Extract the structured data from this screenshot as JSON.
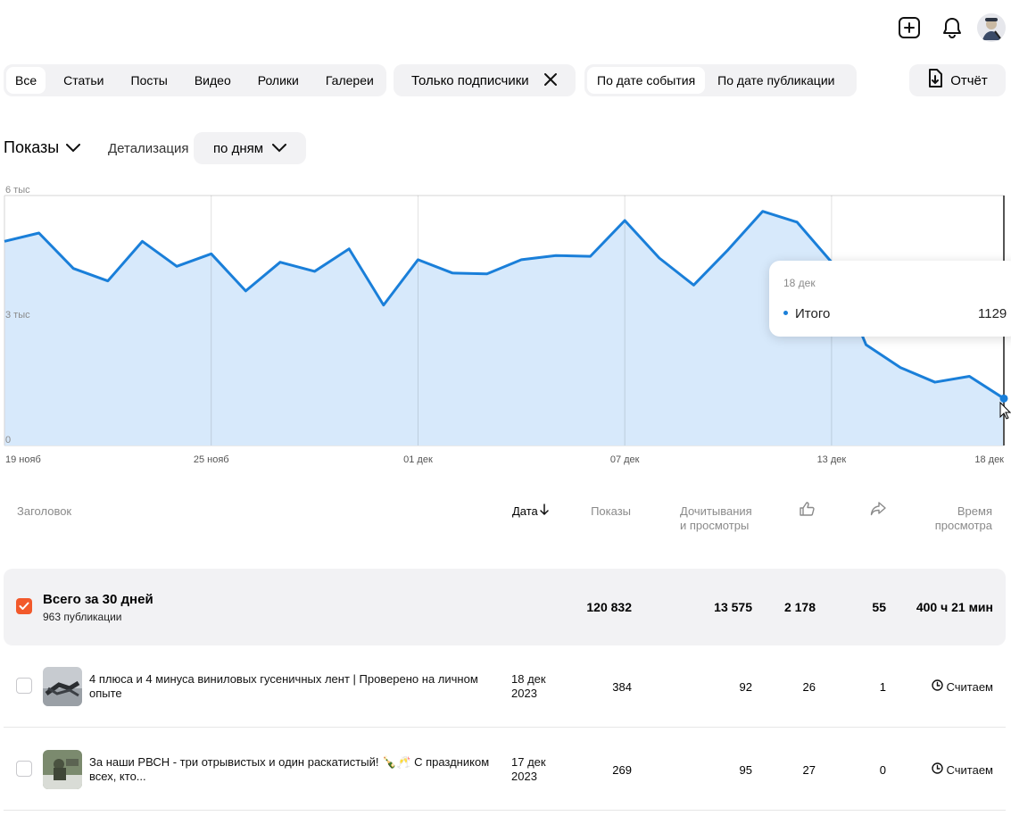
{
  "header": {
    "icons": [
      "plus-square-icon",
      "bell-icon",
      "avatar"
    ]
  },
  "filters": {
    "content_types": [
      {
        "label": "Все",
        "active": true
      },
      {
        "label": "Статьи",
        "active": false
      },
      {
        "label": "Посты",
        "active": false
      },
      {
        "label": "Видео",
        "active": false
      },
      {
        "label": "Ролики",
        "active": false
      },
      {
        "label": "Галереи",
        "active": false
      }
    ],
    "subscribers_chip": "Только подписчики",
    "date_modes": [
      {
        "label": "По дате события",
        "active": true
      },
      {
        "label": "По дате публикации",
        "active": false
      }
    ],
    "report_button": "Отчёт"
  },
  "controls": {
    "metric": "Показы",
    "detail_label": "Детализация",
    "detail_value": "по дням"
  },
  "chart_data": {
    "type": "area",
    "y_ticks": [
      "6 тыс",
      "3 тыс",
      "0"
    ],
    "ylim": [
      0,
      6000
    ],
    "x_tick_labels": [
      "19 нояб",
      "25 нояб",
      "01 дек",
      "07 дек",
      "13 дек",
      "18 дек"
    ],
    "x": [
      "19 нояб",
      "20 нояб",
      "21 нояб",
      "22 нояб",
      "23 нояб",
      "24 нояб",
      "25 нояб",
      "26 нояб",
      "27 нояб",
      "28 нояб",
      "29 нояб",
      "30 нояб",
      "01 дек",
      "02 дек",
      "03 дек",
      "04 дек",
      "05 дек",
      "06 дек",
      "07 дек",
      "08 дек",
      "09 дек",
      "10 дек",
      "11 дек",
      "12 дек",
      "13 дек",
      "14 дек",
      "15 дек",
      "16 дек",
      "17 дек",
      "18 дек"
    ],
    "values": [
      4900,
      5100,
      4250,
      3950,
      4900,
      4300,
      4600,
      3710,
      4400,
      4180,
      4720,
      3370,
      4460,
      4140,
      4120,
      4460,
      4560,
      4540,
      5400,
      4500,
      3850,
      4700,
      5620,
      5360,
      4400,
      2420,
      1870,
      1520,
      1660,
      1129
    ],
    "color": "#1a7fd9",
    "fill": "#d7e9fb",
    "tooltip": {
      "date": "18 дек",
      "series": "Итого",
      "value": "1129"
    }
  },
  "table": {
    "headers": {
      "title": "Заголовок",
      "date": "Дата",
      "views": "Показы",
      "reads_line1": "Дочитывания",
      "reads_line2": "и просмотры",
      "time_line1": "Время",
      "time_line2": "просмотра"
    },
    "summary": {
      "title": "Всего за 30 дней",
      "subtitle": "963 публикации",
      "views": "120 832",
      "reads": "13 575",
      "likes": "2 178",
      "shares": "55",
      "time": "400 ч 21 мин"
    },
    "rows": [
      {
        "title": "4 плюса и 4 минуса виниловых гусеничных лент | Проверено на личном опыте",
        "date_line1": "18 дек",
        "date_line2": "2023",
        "views": "384",
        "reads": "92",
        "likes": "26",
        "shares": "1",
        "time": "Считаем"
      },
      {
        "title": "За наши РВСН - три отрывистых и один раскатистый! 🍾🥂 С праздником всех, кто...",
        "date_line1": "17 дек",
        "date_line2": "2023",
        "views": "269",
        "reads": "95",
        "likes": "27",
        "shares": "0",
        "time": "Считаем"
      }
    ]
  }
}
